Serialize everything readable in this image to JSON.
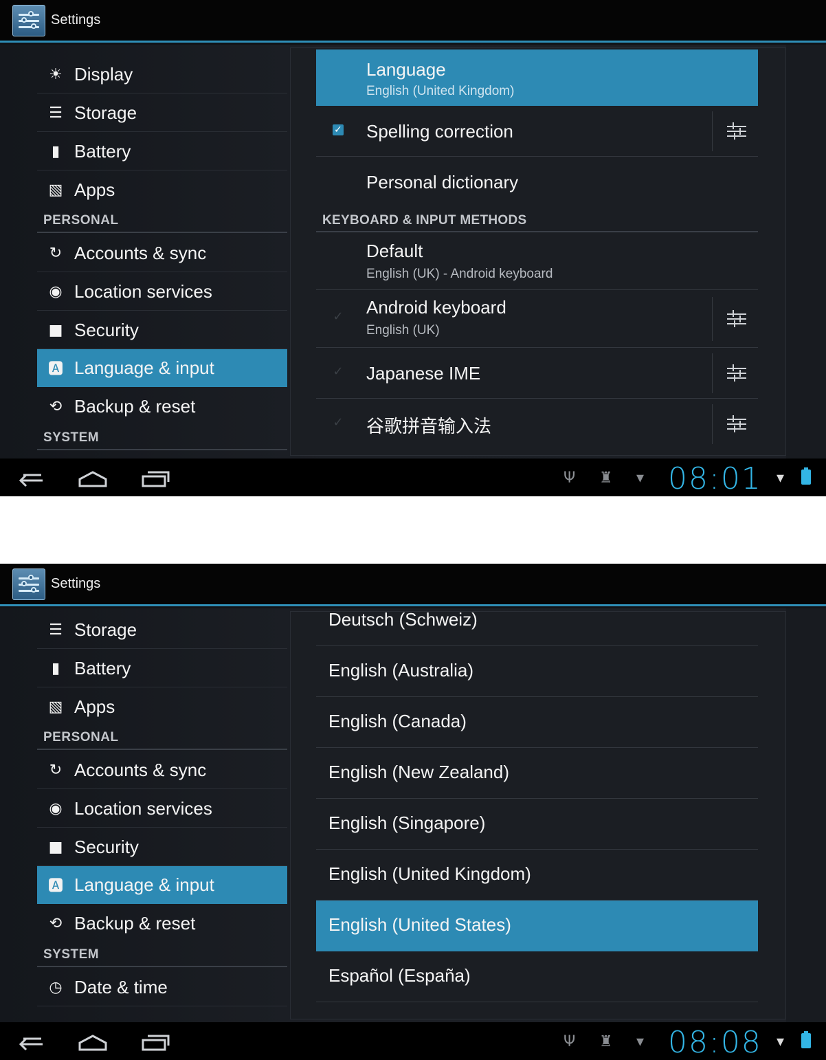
{
  "screens": [
    {
      "app_title": "Settings",
      "sidebar": {
        "items": [
          {
            "label": "Display",
            "icon": "display-icon"
          },
          {
            "label": "Storage",
            "icon": "storage-icon"
          },
          {
            "label": "Battery",
            "icon": "battery-icon"
          },
          {
            "label": "Apps",
            "icon": "apps-icon"
          },
          {
            "label": "Accounts & sync",
            "icon": "sync-icon"
          },
          {
            "label": "Location services",
            "icon": "location-icon"
          },
          {
            "label": "Security",
            "icon": "lock-icon"
          },
          {
            "label": "Language & input",
            "icon": "language-icon",
            "selected": true
          },
          {
            "label": "Backup & reset",
            "icon": "backup-icon"
          }
        ],
        "section_personal": "PERSONAL",
        "section_system": "SYSTEM"
      },
      "main": {
        "language": {
          "title": "Language",
          "summary": "English (United Kingdom)"
        },
        "spelling": {
          "title": "Spelling correction",
          "checked": true
        },
        "dictionary": {
          "title": "Personal dictionary"
        },
        "category": "KEYBOARD & INPUT METHODS",
        "default": {
          "title": "Default",
          "summary": "English (UK) - Android keyboard"
        },
        "android_keyboard": {
          "title": "Android keyboard",
          "summary": "English (UK)"
        },
        "japanese": {
          "title": "Japanese IME"
        },
        "pinyin": {
          "title": "谷歌拼音输入法"
        }
      },
      "status_bar": {
        "clock": "08:01"
      }
    },
    {
      "app_title": "Settings",
      "sidebar": {
        "items": [
          {
            "label": "Storage",
            "icon": "storage-icon"
          },
          {
            "label": "Battery",
            "icon": "battery-icon"
          },
          {
            "label": "Apps",
            "icon": "apps-icon"
          },
          {
            "label": "Accounts & sync",
            "icon": "sync-icon"
          },
          {
            "label": "Location services",
            "icon": "location-icon"
          },
          {
            "label": "Security",
            "icon": "lock-icon"
          },
          {
            "label": "Language & input",
            "icon": "language-icon",
            "selected": true
          },
          {
            "label": "Backup & reset",
            "icon": "backup-icon"
          },
          {
            "label": "Date & time",
            "icon": "clock-icon"
          }
        ],
        "section_personal": "PERSONAL",
        "section_system": "SYSTEM"
      },
      "main": {
        "languages": [
          "Deutsch (Schweiz)",
          "English (Australia)",
          "English (Canada)",
          "English (New Zealand)",
          "English (Singapore)",
          "English (United Kingdom)",
          "English (United States)",
          "Español (España)"
        ],
        "selected_language": "English (United States)"
      },
      "status_bar": {
        "clock": "08:08"
      }
    }
  ],
  "colors": {
    "accent": "#2d8ab4",
    "clock": "#33b5e5",
    "background": "#111317"
  }
}
